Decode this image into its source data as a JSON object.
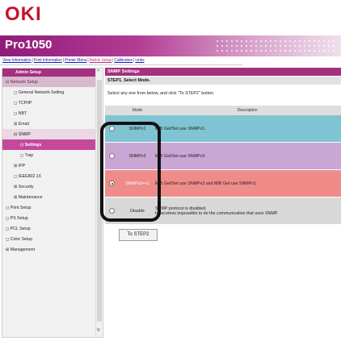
{
  "brand": {
    "logo": "OKI",
    "model": "Pro1050"
  },
  "nav_links": [
    "View Information",
    "Print Information",
    "Printer Menu",
    "Admin Setup",
    "Calibration",
    "Links"
  ],
  "nav_active": "Admin Setup",
  "sidebar": {
    "admin_setup": "Admin Setup",
    "items": [
      "Network Setup",
      "General Network Setting",
      "TCP/IP",
      "NBT",
      "Email",
      "SNMP",
      "Settings",
      "Trap",
      "IPP",
      "IEEE802.1X",
      "Security",
      "Maintenance",
      "Print Setup",
      "PS Setup",
      "PCL Setup",
      "Color Setup",
      "Management"
    ]
  },
  "content": {
    "title": "SNMP Settings",
    "step": "STEP1. Select Mode.",
    "instruction": "Select any one from below, and click \"To STEP2\" button.",
    "headers": {
      "mode": "Mode",
      "description": "Description"
    },
    "modes": [
      {
        "mode": "SNMPv1",
        "description": "MIB Get/Set use SNMPv1.",
        "checked": false,
        "color": "#7fc4d2"
      },
      {
        "mode": "SNMPv3",
        "description": "MIB Get/Set use SNMPv3.",
        "checked": false,
        "color": "#c9a6d3"
      },
      {
        "mode": "SNMPv3+v1",
        "description": "MIB Get/Set use SNMPv3 and MIB Get use SNMPv1.",
        "checked": true,
        "color": "#ef8c8a"
      },
      {
        "mode": "Disable",
        "description": "SNMP protocol is disabled.",
        "description2": "It becomes impossible to do the communication that uses SNMP.",
        "checked": false,
        "color": "#d8d8d8"
      }
    ],
    "button": "To STEP2"
  },
  "colors": {
    "brand_red": "#c8102e",
    "accent_magenta": "#a4307f"
  }
}
